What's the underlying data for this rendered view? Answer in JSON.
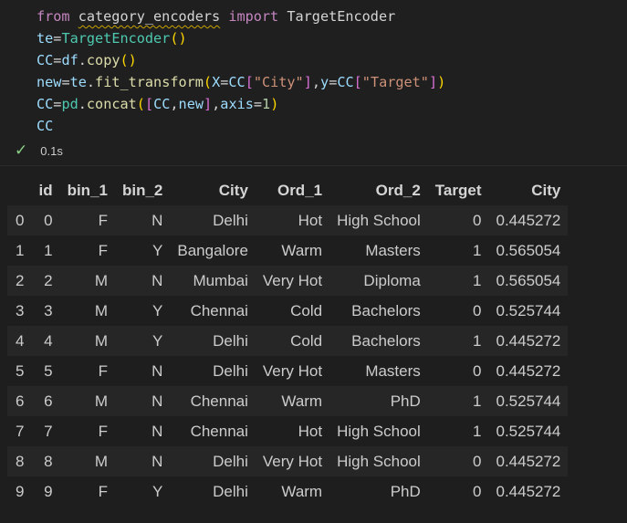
{
  "code": {
    "line1": {
      "kw_from": "from",
      "module": "category_encoders",
      "kw_import": "import",
      "cls": "TargetEncoder"
    },
    "line2": {
      "var": "te",
      "eq": "=",
      "cls": "TargetEncoder",
      "open": "(",
      "close": ")"
    },
    "line3": {
      "var": "CC",
      "eq": "=",
      "obj": "df",
      "dot": ".",
      "fn": "copy",
      "open": "(",
      "close": ")"
    },
    "line4": {
      "var": "new",
      "eq": "=",
      "obj": "te",
      "dot": ".",
      "fn": "fit_transform",
      "open": "(",
      "arg1": "X",
      "eq1": "=",
      "cc1": "CC",
      "lb1": "[",
      "str1": "\"City\"",
      "rb1": "]",
      "comma": ",",
      "arg2": "y",
      "eq2": "=",
      "cc2": "CC",
      "lb2": "[",
      "str2": "\"Target\"",
      "rb2": "]",
      "close": ")"
    },
    "line5": {
      "var": "CC",
      "eq": "=",
      "obj": "pd",
      "dot": ".",
      "fn": "concat",
      "open": "(",
      "lb": "[",
      "a": "CC",
      "comma": ",",
      "b": "new",
      "rb": "]",
      "comma2": ",",
      "kwarg": "axis",
      "eq2": "=",
      "num": "1",
      "close": ")"
    },
    "line6": {
      "var": "CC"
    }
  },
  "status": {
    "check_glyph": "✓",
    "time": "0.1s"
  },
  "table": {
    "columns": [
      "",
      "id",
      "bin_1",
      "bin_2",
      "City",
      "Ord_1",
      "Ord_2",
      "Target",
      "City"
    ],
    "rows": [
      [
        "0",
        "0",
        "F",
        "N",
        "Delhi",
        "Hot",
        "High School",
        "0",
        "0.445272"
      ],
      [
        "1",
        "1",
        "F",
        "Y",
        "Bangalore",
        "Warm",
        "Masters",
        "1",
        "0.565054"
      ],
      [
        "2",
        "2",
        "M",
        "N",
        "Mumbai",
        "Very Hot",
        "Diploma",
        "1",
        "0.565054"
      ],
      [
        "3",
        "3",
        "M",
        "Y",
        "Chennai",
        "Cold",
        "Bachelors",
        "0",
        "0.525744"
      ],
      [
        "4",
        "4",
        "M",
        "Y",
        "Delhi",
        "Cold",
        "Bachelors",
        "1",
        "0.445272"
      ],
      [
        "5",
        "5",
        "F",
        "N",
        "Delhi",
        "Very Hot",
        "Masters",
        "0",
        "0.445272"
      ],
      [
        "6",
        "6",
        "M",
        "N",
        "Chennai",
        "Warm",
        "PhD",
        "1",
        "0.525744"
      ],
      [
        "7",
        "7",
        "F",
        "N",
        "Chennai",
        "Hot",
        "High School",
        "1",
        "0.525744"
      ],
      [
        "8",
        "8",
        "M",
        "N",
        "Delhi",
        "Very Hot",
        "High School",
        "0",
        "0.445272"
      ],
      [
        "9",
        "9",
        "F",
        "Y",
        "Delhi",
        "Warm",
        "PhD",
        "0",
        "0.445272"
      ]
    ]
  },
  "colors": {
    "background": "#1e1e1e",
    "keyword": "#c586c0",
    "variable": "#9cdcfe",
    "function": "#dcdcaa",
    "string": "#ce9178",
    "number": "#b5cea8",
    "class": "#4ec9b0",
    "success": "#89d185"
  }
}
